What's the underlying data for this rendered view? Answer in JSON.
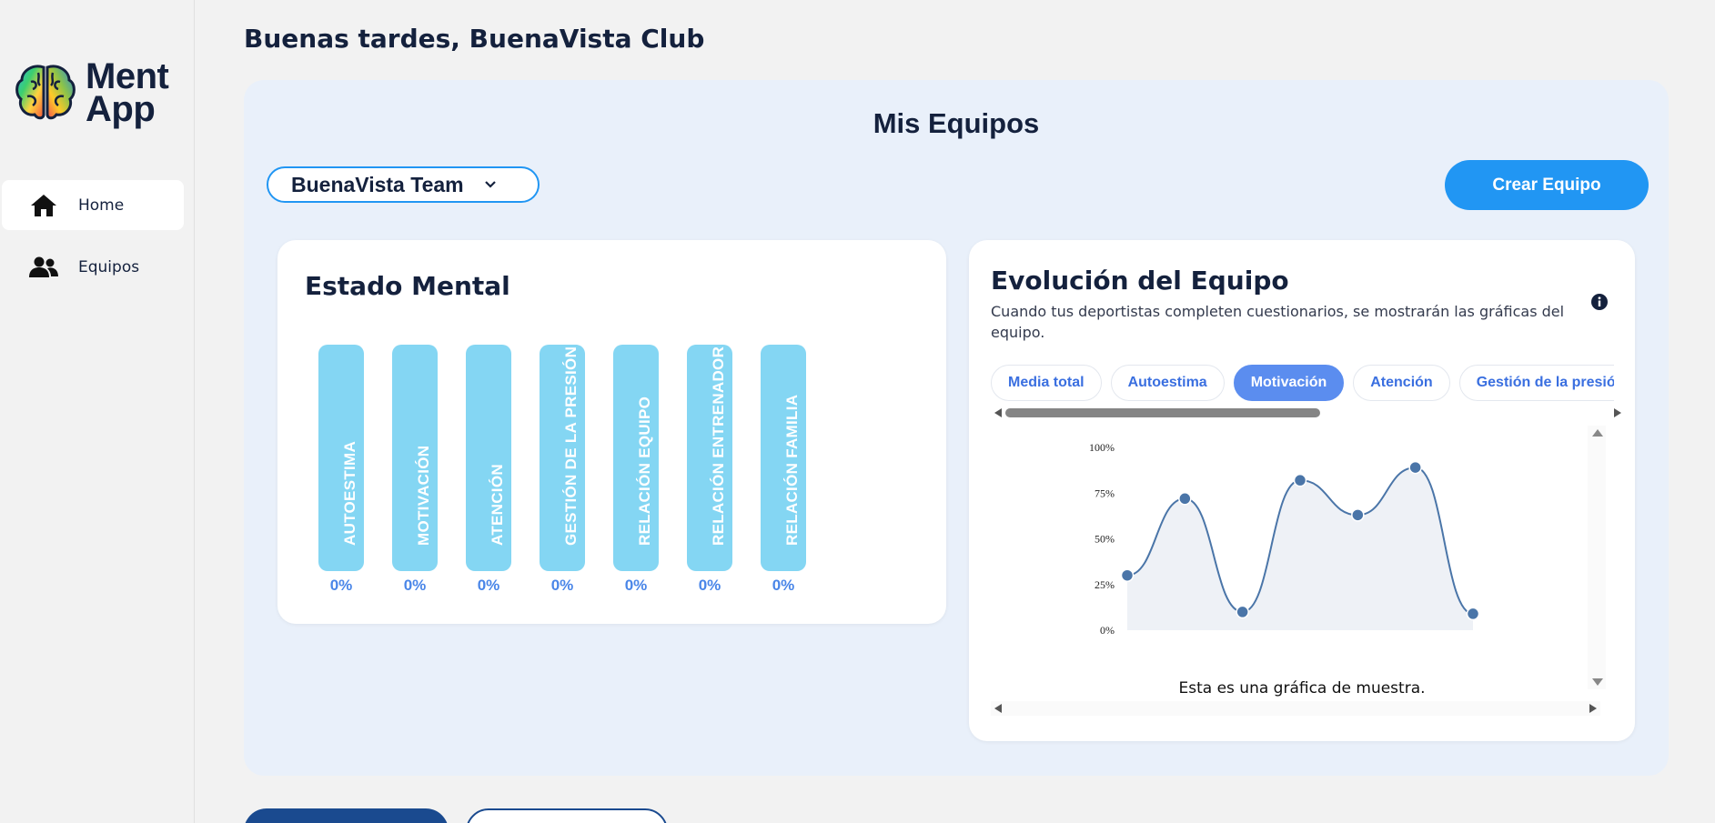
{
  "app": {
    "logo_line1": "Ment",
    "logo_line2": "App"
  },
  "sidebar": {
    "items": [
      {
        "label": "Home",
        "icon": "home-icon",
        "active": true
      },
      {
        "label": "Equipos",
        "icon": "users-icon",
        "active": false
      }
    ]
  },
  "header": {
    "greeting": "Buenas tardes, BuenaVista Club"
  },
  "panel": {
    "title": "Mis Equipos",
    "team_select": {
      "value": "BuenaVista Team"
    },
    "create_button": "Crear Equipo"
  },
  "mental": {
    "title": "Estado Mental",
    "bars": [
      {
        "label": "AUTOESTIMA",
        "value": "0%"
      },
      {
        "label": "MOTIVACIÓN",
        "value": "0%"
      },
      {
        "label": "ATENCIÓN",
        "value": "0%"
      },
      {
        "label": "GESTIÓN DE LA PRESIÓN",
        "value": "0%"
      },
      {
        "label": "RELACIÓN EQUIPO",
        "value": "0%"
      },
      {
        "label": "RELACIÓN ENTRENADOR",
        "value": "0%"
      },
      {
        "label": "RELACIÓN FAMILIA",
        "value": "0%"
      }
    ]
  },
  "evolution": {
    "title": "Evolución del Equipo",
    "description": "Cuando tus deportistas completen cuestionarios, se mostrarán las gráficas del equipo.",
    "tabs": [
      {
        "label": "Media total",
        "active": false
      },
      {
        "label": "Autoestima",
        "active": false
      },
      {
        "label": "Motivación",
        "active": true
      },
      {
        "label": "Atención",
        "active": false
      },
      {
        "label": "Gestión de la presión",
        "active": false
      }
    ],
    "caption": "Esta es una gráfica de muestra."
  },
  "colors": {
    "accent": "#2196f3",
    "bar": "#84d6f3",
    "tab_active": "#5b8def",
    "line": "#4a75a8"
  },
  "chart_data": {
    "type": "line",
    "title": "",
    "xlabel": "",
    "ylabel": "",
    "x": [
      1,
      2,
      3,
      4,
      5,
      6,
      7
    ],
    "series": [
      {
        "values": [
          30,
          72,
          10,
          82,
          63,
          89,
          9
        ]
      }
    ],
    "y_ticks": [
      "0%",
      "25%",
      "50%",
      "75%",
      "100%"
    ],
    "ylim": [
      0,
      100
    ],
    "grid": false,
    "smooth": true,
    "area_fill": true
  }
}
